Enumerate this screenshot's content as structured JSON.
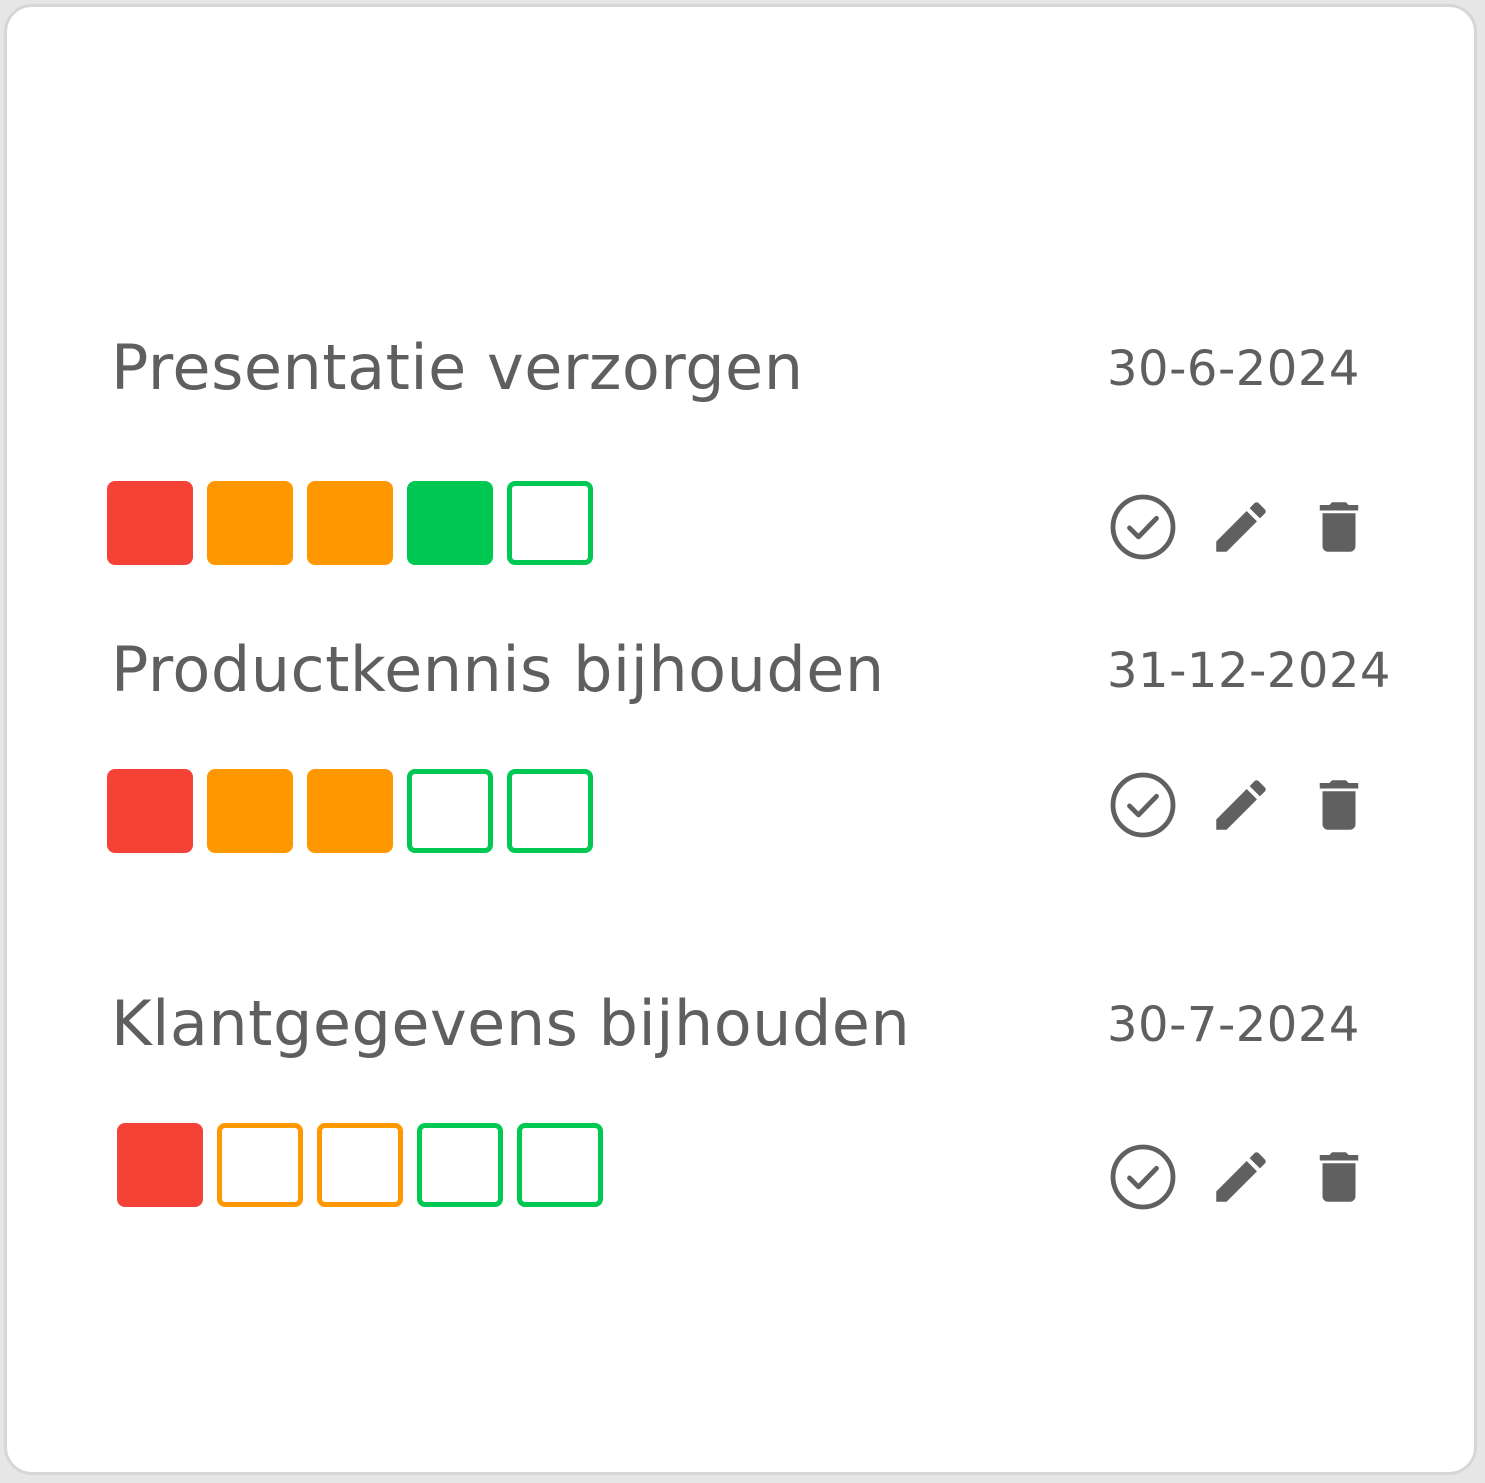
{
  "colors": {
    "red": "#f44336",
    "orange": "#ff9800",
    "green": "#00c853",
    "text": "#5f5f5f",
    "icon": "#606060"
  },
  "icons": {
    "complete": "check-circle-icon",
    "edit": "pencil-icon",
    "delete": "trash-icon"
  },
  "tasks": [
    {
      "title": "Presentatie verzorgen",
      "date": "30-6-2024",
      "progress_filled": 4,
      "progress_total": 5
    },
    {
      "title": "Productkennis bijhouden",
      "date": "31-12-2024",
      "progress_filled": 3,
      "progress_total": 5
    },
    {
      "title": "Klantgegevens bijhouden",
      "date": "30-7-2024",
      "progress_filled": 1,
      "progress_total": 5
    }
  ]
}
